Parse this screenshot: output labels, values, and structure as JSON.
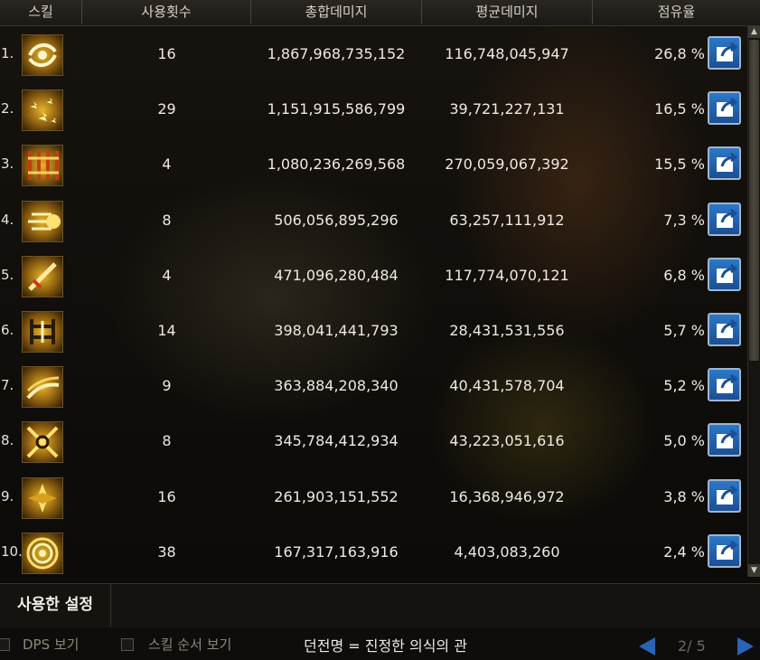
{
  "headers": {
    "skill": "스킬",
    "uses": "사용횟수",
    "total_damage": "총합데미지",
    "avg_damage": "평균데미지",
    "share": "점유율"
  },
  "rows": [
    {
      "rank": "1.",
      "icon": "skill-swirl-icon",
      "uses": "16",
      "total": "1,867,968,735,152",
      "avg": "116,748,045,947",
      "share": "26,8 %"
    },
    {
      "rank": "2.",
      "icon": "skill-starburst-icon",
      "uses": "29",
      "total": "1,151,915,586,799",
      "avg": "39,721,227,131",
      "share": "16,5 %"
    },
    {
      "rank": "3.",
      "icon": "skill-chains-icon",
      "uses": "4",
      "total": "1,080,236,269,568",
      "avg": "270,059,067,392",
      "share": "15,5 %"
    },
    {
      "rank": "4.",
      "icon": "skill-charge-icon",
      "uses": "8",
      "total": "506,056,895,296",
      "avg": "63,257,111,912",
      "share": "7,3 %"
    },
    {
      "rank": "5.",
      "icon": "skill-slash-icon",
      "uses": "4",
      "total": "471,096,280,484",
      "avg": "117,774,070,121",
      "share": "6,8 %"
    },
    {
      "rank": "6.",
      "icon": "skill-bind-icon",
      "uses": "14",
      "total": "398,041,441,793",
      "avg": "28,431,531,556",
      "share": "5,7 %"
    },
    {
      "rank": "7.",
      "icon": "skill-sweep-icon",
      "uses": "9",
      "total": "363,884,208,340",
      "avg": "40,431,578,704",
      "share": "5,2 %"
    },
    {
      "rank": "8.",
      "icon": "skill-chain-lattice-icon",
      "uses": "8",
      "total": "345,784,412,934",
      "avg": "43,223,051,616",
      "share": "5,0 %"
    },
    {
      "rank": "9.",
      "icon": "skill-cross-icon",
      "uses": "16",
      "total": "261,903,151,552",
      "avg": "16,368,946,972",
      "share": "3,8 %"
    },
    {
      "rank": "10.",
      "icon": "skill-ring-icon",
      "uses": "38",
      "total": "167,317,163,916",
      "avg": "4,403,083,260",
      "share": "2,4 %"
    }
  ],
  "settings_tab": "사용한 설정",
  "footer": {
    "dps_label": "DPS 보기",
    "skill_order_label": "스킬 순서 보기",
    "dungeon_text": "던전명 = 진정한 의식의 관",
    "page_text": "2/ 5"
  },
  "colors": {
    "accent_blue": "#2b63b5",
    "icon_gold": "#e8b52a"
  }
}
